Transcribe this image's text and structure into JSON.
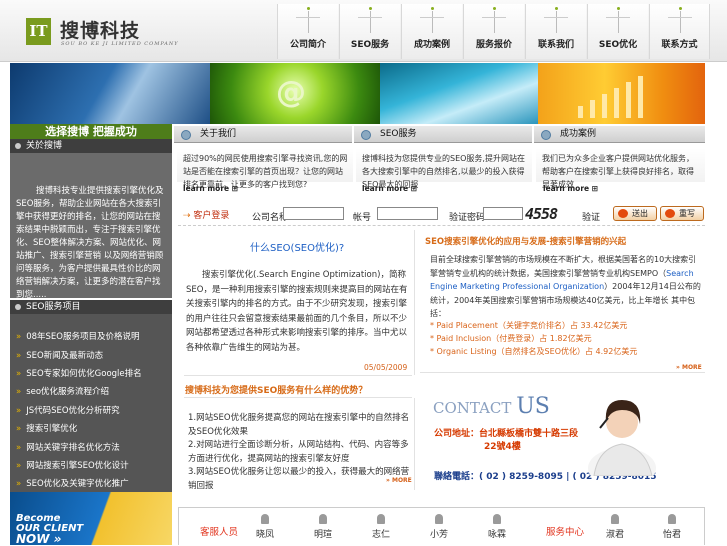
{
  "header": {
    "logo_mark": "IT",
    "logo_name": "搜博科技",
    "logo_sub": "SOU BO KE JI LIMITED COMPANY",
    "nav": [
      "公司简介",
      "SEO服务",
      "成功案例",
      "服务报价",
      "联系我们",
      "SEO优化",
      "联系方式"
    ]
  },
  "banner": {
    "at_symbol": "@"
  },
  "left": {
    "slogan": "选择搜博 把握成功",
    "about_title": "关於搜博",
    "about_text": "搜博科技专业提供搜索引擎优化及SEO服务，帮助企业网站在各大搜索引擎中获得更好的排名，让您的网站在搜索结果中脱颖而出，专注于搜索引擎优化、SEO整体解决方案、网站优化、网站推广、搜索引擎营销 以及网络营销顾问等服务，为客户提供最具性价比的网络营销解决方案，让更多的潜在客户找到您.....",
    "svc_title": "SEO服务项目",
    "svc_items": [
      "08年SEO服务项目及价格说明",
      "SEO新闻及最新动态",
      "SEO专家如何优化Google排名",
      "seo优化服务流程介绍",
      "JS代码SEO优化分析研究",
      "搜索引擎优化",
      "网站关键字排名优化方法",
      "网站搜索引擎SEO优化设计",
      "SEO优化及关键字优化推广"
    ],
    "client_banner": [
      "Become",
      "OUR CLIENT",
      "NOW »"
    ]
  },
  "cols": [
    {
      "title": "关于我们",
      "body": "超过90%的网民使用搜索引擎寻找资讯,您的网站是否能在搜索引擎的首页出现？让您的网站排名更靠前，让更多的客户找到您?",
      "more": "learn more"
    },
    {
      "title": "SEO服务",
      "body": "搜博科技为您提供专业的SEO服务,提升网站在各大搜索引擎中的自然排名,以最少的投入获得SEO最大的回报",
      "more": "learn more"
    },
    {
      "title": "成功案例",
      "body": "我们已为众多企业客户提供网站优化服务，帮助客户在搜索引擎上获得良好排名，取得显著成效",
      "more": "learn more"
    }
  ],
  "login": {
    "label": "客户登录",
    "company_label": "公司名称",
    "account_label": "帐号",
    "password_label": "验证密码",
    "captcha": "4558",
    "code_label": "验证",
    "submit": "送出",
    "reset": "重写"
  },
  "whatseo": {
    "title": "什么SEO(SEO优化)?",
    "text": "搜索引擎优化(.Search Engine Optimization)，简称SEO，是一种利用搜索引擎的搜索规则来提高目的网站在有关搜索引擎内的排名的方式。由于不少研究发现，搜索引擎的用户往往只会留意搜索结果最前面的几个条目，所以不少网站都希望透过各种形式来影响搜索引擎的排序。当中尤以各种依靠广告维生的网站为甚。",
    "date": "05/05/2009"
  },
  "intro": {
    "title": "SEO搜索引擎优化的应用与发展-搜索引擎营销的兴起",
    "text_before": "目前全球搜索引擎营销的市场规模在不断扩大，根据美国著名的10大搜索引擎营销专业机构的统计数据，美国搜索引擎营销专业机构SEMPO（",
    "link": "Search Engine Marketing Professional Organization",
    "text_after": "）2004年12月14日公布的统计，2004年美国搜索引擎营销市场规模达40亿美元，比上年增长 其中包括：",
    "stats": [
      "* Paid Placement（关键字竞价排名）占 33.42亿美元",
      "* Paid Inclusion（付费登录）占 1.82亿美元",
      "* Organic Listing（自然排名及SEO优化）占 4.92亿美元"
    ],
    "more": "MORE"
  },
  "news": {
    "title": "搜博科技为您提供SEO服务有什么样的优势？",
    "items": [
      "1.网站SEO优化服务提高您的网站在搜索引擎中的自然排名及SEO优化效果",
      "2.对网站进行全面诊断分析，从网站结构、代码、内容等多方面进行优化，提高网站的搜索引擎友好度",
      "3.网站SEO优化服务让您以最少的投入，获得最大的网络营销回报"
    ],
    "more": "MORE"
  },
  "contact": {
    "logo_a": "CONTACT",
    "logo_b": "US",
    "addr_line1": "公司地址：台北縣板橋市雙十路三段",
    "addr_line2": "22號4樓",
    "phone": "聯絡電話：( 02 ) 8259-8095 | ( 02 ) 8259-8015"
  },
  "strip": {
    "label_left": "客服人员",
    "label_right": "服务中心",
    "names": [
      "晓凤",
      "明瑄",
      "志仁",
      "小芳",
      "咏霖",
      "淑君",
      "怡君"
    ]
  }
}
